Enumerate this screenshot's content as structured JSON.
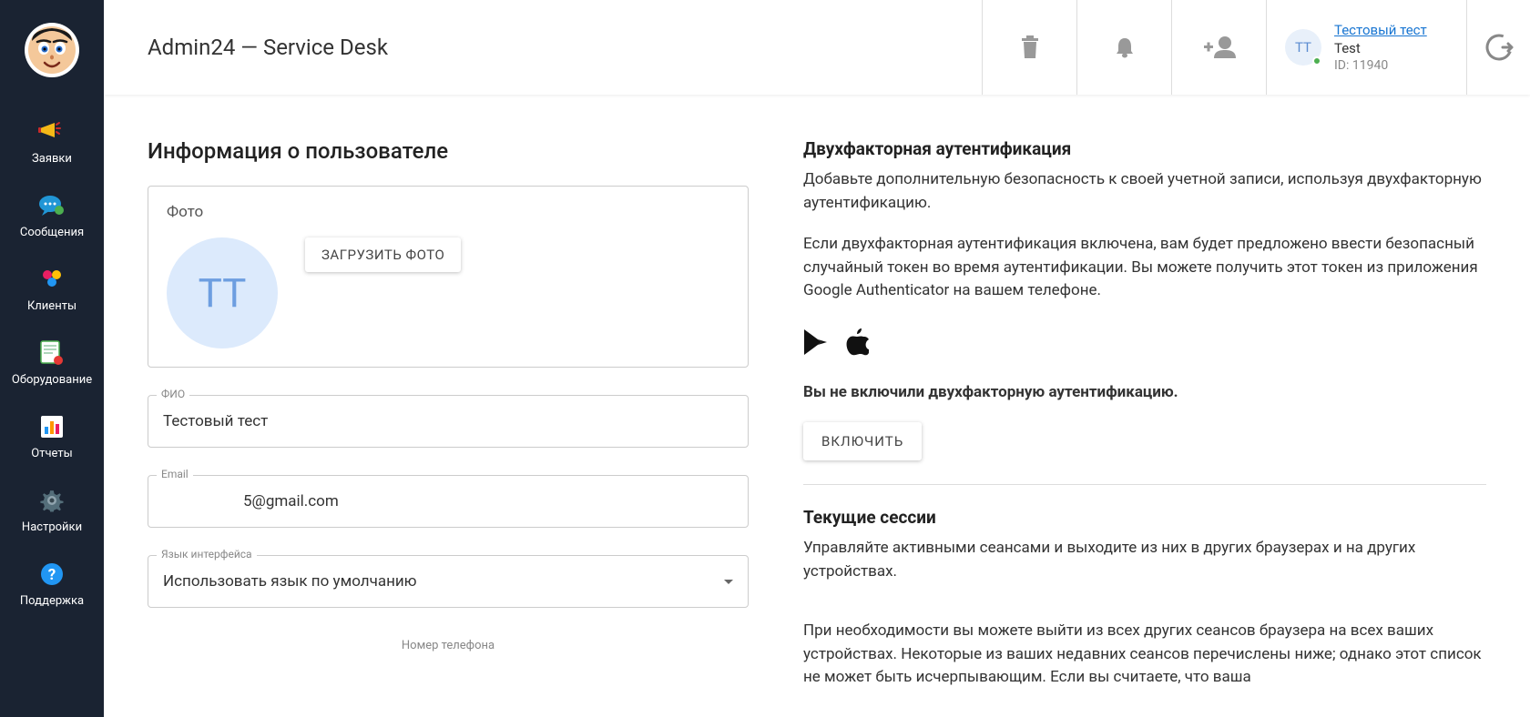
{
  "sidebar": {
    "items": [
      {
        "label": "Заявки"
      },
      {
        "label": "Сообщения"
      },
      {
        "label": "Клиенты"
      },
      {
        "label": "Оборудование"
      },
      {
        "label": "Отчеты"
      },
      {
        "label": "Настройки"
      },
      {
        "label": "Поддержка"
      }
    ]
  },
  "topbar": {
    "title": "Admin24 — Service Desk",
    "user": {
      "initials": "ТТ",
      "name": "Тестовый тест",
      "company": "Test",
      "id_label": "ID: 11940"
    }
  },
  "profile": {
    "section_title": "Информация о пользователе",
    "photo_label": "Фото",
    "avatar_initials": "ТТ",
    "upload_btn": "ЗАГРУЗИТЬ ФОТО",
    "fio_label": "ФИО",
    "fio_value": "Тестовый тест",
    "email_label": "Email",
    "email_value": "5@gmail.com",
    "lang_label": "Язык интерфейса",
    "lang_value": "Использовать язык по умолчанию",
    "phone_label": "Номер телефона"
  },
  "twofa": {
    "title": "Двухфакторная аутентификация",
    "desc1": "Добавьте дополнительную безопасность к своей учетной записи, используя двухфакторную аутентификацию.",
    "desc2": "Если двухфакторная аутентификация включена, вам будет предложено ввести безопасный случайный токен во время аутентификации. Вы можете получить этот токен из приложения Google Authenticator на вашем телефоне.",
    "status": "Вы не включили двухфакторную аутентификацию.",
    "enable_btn": "ВКЛЮЧИТЬ"
  },
  "sessions": {
    "title": "Текущие сессии",
    "desc1": "Управляйте активными сеансами и выходите из них в других браузерах и на других устройствах.",
    "desc2": "При необходимости вы можете выйти из всех других сеансов браузера на всех ваших устройствах. Некоторые из ваших недавних сеансов перечислены ниже; однако этот список не может быть исчерпывающим. Если вы считаете, что ваша"
  }
}
